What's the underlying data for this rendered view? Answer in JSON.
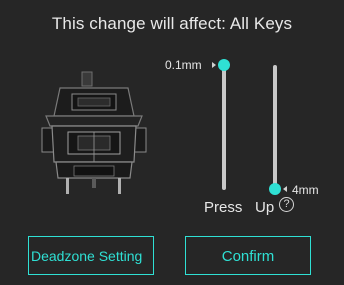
{
  "header": {
    "title": "This change will affect: All Keys"
  },
  "switch_image": {
    "icon": "mechanical-switch-icon"
  },
  "sliders": {
    "press": {
      "label": "Press",
      "value_label": "0.1mm",
      "value_mm": 0.1,
      "fraction": 0
    },
    "up": {
      "label": "Up",
      "value_label": "4mm",
      "value_mm": 4,
      "fraction": 1
    }
  },
  "help": {
    "symbol": "?"
  },
  "buttons": {
    "deadzone_label": "Deadzone Setting",
    "confirm_label": "Confirm"
  },
  "colors": {
    "background": "#262626",
    "accent": "#2fe0d4",
    "track": "#c8c8c8"
  }
}
